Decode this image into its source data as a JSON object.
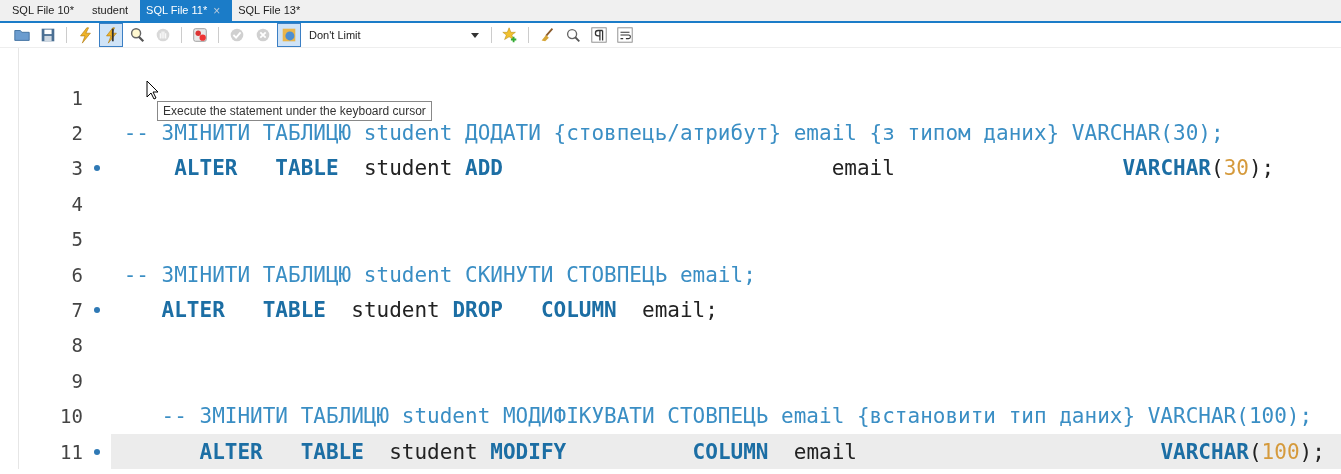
{
  "tabs": [
    {
      "label": "SQL File 10*",
      "selected": false,
      "closable": false
    },
    {
      "label": "student",
      "selected": false,
      "closable": false
    },
    {
      "label": "SQL File 11*",
      "selected": true,
      "closable": true,
      "close": "×"
    },
    {
      "label": "SQL File 13*",
      "selected": false,
      "closable": false
    }
  ],
  "toolbar": [
    {
      "kind": "button",
      "disabled": false,
      "pressed": false
    },
    {
      "kind": "button",
      "disabled": false,
      "pressed": false
    },
    {
      "kind": "separator"
    },
    {
      "kind": "button",
      "disabled": false,
      "pressed": false
    },
    {
      "kind": "button",
      "disabled": false,
      "pressed": true
    },
    {
      "kind": "button",
      "disabled": false,
      "pressed": false
    },
    {
      "kind": "button",
      "disabled": true,
      "pressed": false
    },
    {
      "kind": "separator"
    },
    {
      "kind": "button",
      "disabled": false,
      "pressed": false
    },
    {
      "kind": "separator"
    },
    {
      "kind": "button",
      "disabled": true,
      "pressed": false
    },
    {
      "kind": "button",
      "disabled": true,
      "pressed": false
    },
    {
      "kind": "button",
      "disabled": false,
      "pressed": true
    },
    {
      "kind": "select",
      "value": "Don't Limit"
    },
    {
      "kind": "separator"
    },
    {
      "kind": "button",
      "disabled": false,
      "pressed": false
    },
    {
      "kind": "separator"
    },
    {
      "kind": "button",
      "disabled": false,
      "pressed": false
    },
    {
      "kind": "button",
      "disabled": false,
      "pressed": false
    },
    {
      "kind": "button",
      "disabled": false,
      "pressed": false
    },
    {
      "kind": "button",
      "disabled": false,
      "pressed": false
    }
  ],
  "tooltip": {
    "text": "Execute the statement under the keyboard cursor"
  },
  "editor": {
    "lines": [
      {
        "number": "1",
        "statement": false,
        "current": false
      },
      {
        "number": "2",
        "statement": false,
        "current": false,
        "tokens": [
          {
            "kind": "comment",
            "text": " -- ЗМІНИТИ ТАБЛИЦЮ student ДОДАТИ {стовпець/атрибут} email {з типом даних} VARCHAR(30);"
          }
        ]
      },
      {
        "number": "3",
        "statement": true,
        "current": false,
        "tokens": [
          {
            "kind": "keyword",
            "text": "     ALTER"
          },
          {
            "kind": "keyword",
            "text": "   TABLE"
          },
          {
            "kind": "plain",
            "text": "  student"
          },
          {
            "kind": "keyword",
            "text": " ADD"
          },
          {
            "kind": "plain",
            "text": "                          email"
          },
          {
            "kind": "keyword",
            "text": "                  VARCHAR"
          },
          {
            "kind": "plain",
            "text": "("
          },
          {
            "kind": "number",
            "text": "30"
          },
          {
            "kind": "plain",
            "text": ");"
          }
        ]
      },
      {
        "number": "4",
        "statement": false,
        "current": false
      },
      {
        "number": "5",
        "statement": false,
        "current": false
      },
      {
        "number": "6",
        "statement": false,
        "current": false,
        "tokens": [
          {
            "kind": "comment",
            "text": " -- ЗМІНИТИ ТАБЛИЦЮ student СКИНУТИ СТОВПЕЦЬ email;"
          }
        ]
      },
      {
        "number": "7",
        "statement": true,
        "current": false,
        "tokens": [
          {
            "kind": "keyword",
            "text": "    ALTER"
          },
          {
            "kind": "keyword",
            "text": "   TABLE"
          },
          {
            "kind": "plain",
            "text": "  student"
          },
          {
            "kind": "keyword",
            "text": " DROP"
          },
          {
            "kind": "keyword",
            "text": "   COLUMN"
          },
          {
            "kind": "plain",
            "text": "  email;"
          }
        ]
      },
      {
        "number": "8",
        "statement": false,
        "current": false
      },
      {
        "number": "9",
        "statement": false,
        "current": false
      },
      {
        "number": "10",
        "statement": false,
        "current": false,
        "tokens": [
          {
            "kind": "comment",
            "text": "    -- ЗМІНИТИ ТАБЛИЦЮ student МОДИФІКУВАТИ СТОВПЕЦЬ email {встановити тип даних} VARCHAR(100);"
          }
        ]
      },
      {
        "number": "11",
        "statement": true,
        "current": true,
        "tokens": [
          {
            "kind": "keyword",
            "text": "       ALTER"
          },
          {
            "kind": "keyword",
            "text": "   TABLE"
          },
          {
            "kind": "plain",
            "text": "  student"
          },
          {
            "kind": "keyword",
            "text": " MODIFY"
          },
          {
            "kind": "keyword",
            "text": "          COLUMN"
          },
          {
            "kind": "plain",
            "text": "  email"
          },
          {
            "kind": "keyword",
            "text": "                        VARCHAR"
          },
          {
            "kind": "plain",
            "text": "("
          },
          {
            "kind": "number",
            "text": "100"
          },
          {
            "kind": "plain",
            "text": ");"
          }
        ]
      }
    ]
  }
}
